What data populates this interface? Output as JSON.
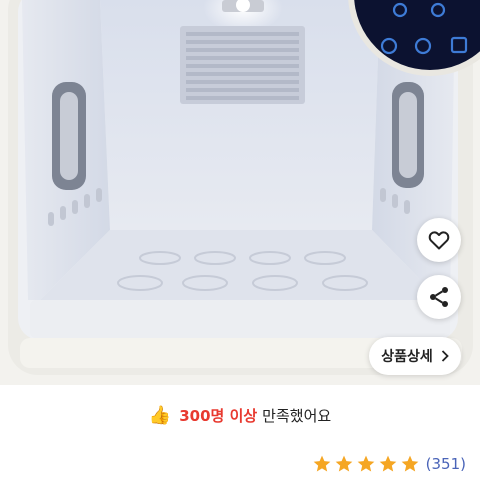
{
  "actions": {
    "like_icon": "heart-outline-icon",
    "share_icon": "share-icon",
    "detail_label": "상품상세",
    "detail_icon": "chevron-right-icon"
  },
  "satisfaction": {
    "icon": "thumbs-up-icon",
    "highlight": "300명 이상",
    "text": "만족했어요"
  },
  "rating": {
    "stars": 5,
    "max_stars": 5,
    "count": "(351)",
    "star_color": "#f5a623",
    "count_color": "#4a64b8"
  },
  "colors": {
    "highlight": "#e8392f",
    "panel_led": "#3e7bd6"
  }
}
